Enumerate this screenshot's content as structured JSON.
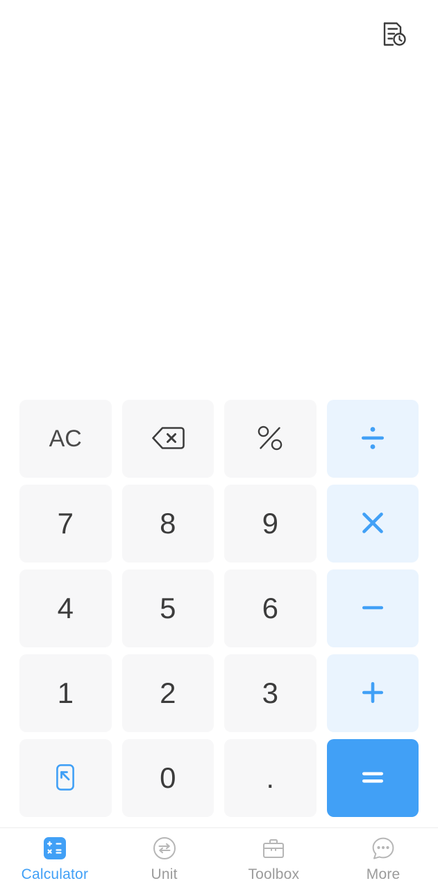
{
  "app": {
    "name": "Calculator",
    "accent_color": "#41a0f6",
    "operator_key_bg": "#eaf4fe",
    "digit_key_bg": "#f7f7f8",
    "page_bg": "#ffffff",
    "digit_text_color": "#3c3c3c"
  },
  "header": {
    "history_button": {
      "icon": "history-document-clock-icon",
      "label": "History"
    }
  },
  "display": {
    "expression": "",
    "result": ""
  },
  "keypad": {
    "keys": [
      {
        "id": "clear",
        "label": "AC",
        "icon": "",
        "kind": "func",
        "style": "plain"
      },
      {
        "id": "backspace",
        "label": "",
        "icon": "backspace-icon",
        "kind": "icon",
        "style": "plain"
      },
      {
        "id": "percent",
        "label": "",
        "icon": "percent-icon",
        "kind": "icon",
        "style": "plain"
      },
      {
        "id": "divide",
        "label": "",
        "icon": "divide-icon",
        "kind": "icon",
        "style": "operator"
      },
      {
        "id": "seven",
        "label": "7",
        "icon": "",
        "kind": "digit",
        "style": "plain"
      },
      {
        "id": "eight",
        "label": "8",
        "icon": "",
        "kind": "digit",
        "style": "plain"
      },
      {
        "id": "nine",
        "label": "9",
        "icon": "",
        "kind": "digit",
        "style": "plain"
      },
      {
        "id": "multiply",
        "label": "",
        "icon": "multiply-icon",
        "kind": "icon",
        "style": "operator"
      },
      {
        "id": "four",
        "label": "4",
        "icon": "",
        "kind": "digit",
        "style": "plain"
      },
      {
        "id": "five",
        "label": "5",
        "icon": "",
        "kind": "digit",
        "style": "plain"
      },
      {
        "id": "six",
        "label": "6",
        "icon": "",
        "kind": "digit",
        "style": "plain"
      },
      {
        "id": "minus",
        "label": "",
        "icon": "minus-icon",
        "kind": "icon",
        "style": "operator"
      },
      {
        "id": "one",
        "label": "1",
        "icon": "",
        "kind": "digit",
        "style": "plain"
      },
      {
        "id": "two",
        "label": "2",
        "icon": "",
        "kind": "digit",
        "style": "plain"
      },
      {
        "id": "three",
        "label": "3",
        "icon": "",
        "kind": "digit",
        "style": "plain"
      },
      {
        "id": "plus",
        "label": "",
        "icon": "plus-icon",
        "kind": "icon",
        "style": "operator"
      },
      {
        "id": "expand",
        "label": "",
        "icon": "expand-arrow-icon",
        "kind": "icon",
        "style": "plain"
      },
      {
        "id": "zero",
        "label": "0",
        "icon": "",
        "kind": "digit",
        "style": "plain"
      },
      {
        "id": "decimal",
        "label": ".",
        "icon": "",
        "kind": "dot",
        "style": "plain"
      },
      {
        "id": "equals",
        "label": "",
        "icon": "equals-icon",
        "kind": "icon",
        "style": "equals"
      }
    ]
  },
  "tabbar": {
    "items": [
      {
        "id": "calculator",
        "label": "Calculator",
        "icon": "calculator-icon",
        "active": true
      },
      {
        "id": "unit",
        "label": "Unit",
        "icon": "unit-convert-icon",
        "active": false
      },
      {
        "id": "toolbox",
        "label": "Toolbox",
        "icon": "briefcase-icon",
        "active": false
      },
      {
        "id": "more",
        "label": "More",
        "icon": "more-bubble-icon",
        "active": false
      }
    ]
  }
}
